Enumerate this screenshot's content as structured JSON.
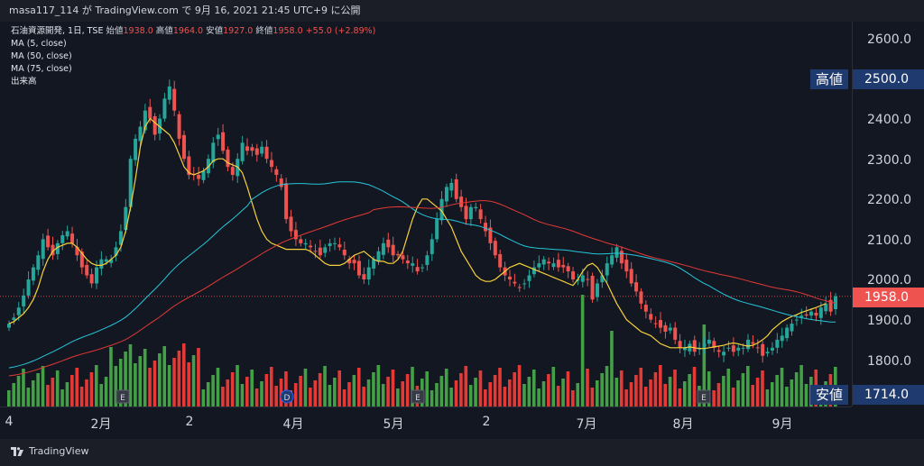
{
  "topbar": {
    "text": "masa117_114 が TradingView.com で 9月 16, 2021 21:45 UTC+9 に公開"
  },
  "legend": {
    "symbol": "石油資源開発, 1日, TSE",
    "open_label": "始値",
    "open": "1938.0",
    "high_label": "高値",
    "high": "1964.0",
    "low_label": "安値",
    "low": "1927.0",
    "close_label": "終値",
    "close": "1958.0",
    "change": "+55.0 (+2.89%)",
    "ma5": "MA (5, close)",
    "ma50": "MA (50, close)",
    "ma75": "MA (75, close)",
    "volume": "出来高"
  },
  "price_axis": {
    "ticks": [
      "2600.0",
      "2400.0",
      "2300.0",
      "2200.0",
      "2100.0",
      "2000.0",
      "1900.0",
      "1800.0"
    ],
    "high_tag": "2500.0",
    "last_tag": "1958.0",
    "low_tag": "1714.0",
    "high_name": "高値",
    "low_name": "安値"
  },
  "time_axis": {
    "labels": [
      "4",
      "2月",
      "2",
      "4月",
      "5月",
      "2",
      "7月",
      "8月",
      "9月"
    ]
  },
  "markers": {
    "earnings": "E",
    "dividend": "D"
  },
  "footer": {
    "brand": "TradingView"
  },
  "colors": {
    "up": "#26a69a",
    "down": "#ef5350",
    "ma5": "#f7d13b",
    "ma50": "#26c6da",
    "ma75": "#e53935",
    "vol_up": "#43a047",
    "vol_down": "#e53935",
    "tag_bg": "#1e3a6e",
    "last_bg": "#ef5350"
  },
  "chart_data": {
    "type": "candlestick",
    "title": "石油資源開発, 1日, TSE",
    "ylim": [
      1700,
      2650
    ],
    "price_ticks": [
      1800,
      1900,
      2000,
      2100,
      2200,
      2300,
      2400,
      2600
    ],
    "last_price": 1958.0,
    "period_high": 2500.0,
    "period_low": 1714.0,
    "ohlc_last": {
      "open": 1938.0,
      "high": 1964.0,
      "low": 1927.0,
      "close": 1958.0,
      "change": 55.0,
      "change_pct": 2.89
    },
    "close": [
      1890,
      1905,
      1930,
      1960,
      2000,
      2030,
      2060,
      2100,
      2080,
      2060,
      2090,
      2110,
      2120,
      2090,
      2060,
      2030,
      2010,
      1990,
      2030,
      2050,
      2050,
      2050,
      2080,
      2120,
      2180,
      2300,
      2350,
      2380,
      2420,
      2400,
      2360,
      2400,
      2450,
      2480,
      2420,
      2350,
      2300,
      2260,
      2260,
      2250,
      2270,
      2300,
      2340,
      2360,
      2320,
      2280,
      2260,
      2300,
      2340,
      2320,
      2320,
      2310,
      2330,
      2300,
      2280,
      2260,
      2230,
      2150,
      2120,
      2100,
      2090,
      2090,
      2080,
      2070,
      2060,
      2080,
      2090,
      2090,
      2080,
      2060,
      2040,
      2040,
      2010,
      2000,
      2030,
      2050,
      2070,
      2090,
      2080,
      2060,
      2060,
      2050,
      2040,
      2040,
      2020,
      2030,
      2060,
      2100,
      2150,
      2200,
      2230,
      2240,
      2200,
      2180,
      2150,
      2180,
      2180,
      2150,
      2120,
      2090,
      2060,
      2030,
      2010,
      2000,
      1990,
      1980,
      1990,
      2010,
      2030,
      2040,
      2050,
      2040,
      2040,
      2030,
      2030,
      2020,
      2000,
      2000,
      2010,
      2000,
      1950,
      1990,
      2010,
      2040,
      2060,
      2080,
      2040,
      2020,
      1990,
      1970,
      1940,
      1920,
      1900,
      1890,
      1880,
      1870,
      1880,
      1850,
      1830,
      1830,
      1840,
      1820,
      1830,
      1840,
      1850,
      1830,
      1820,
      1820,
      1830,
      1820,
      1830,
      1830,
      1850,
      1840,
      1830,
      1810,
      1820,
      1830,
      1850,
      1860,
      1880,
      1890,
      1900,
      1910,
      1910,
      1920,
      1910,
      1930,
      1940,
      1920,
      1958
    ],
    "ma5": [
      1890,
      1895,
      1905,
      1915,
      1930,
      1950,
      1980,
      2020,
      2050,
      2070,
      2080,
      2085,
      2090,
      2090,
      2080,
      2065,
      2050,
      2040,
      2035,
      2035,
      2040,
      2050,
      2060,
      2080,
      2120,
      2180,
      2250,
      2330,
      2380,
      2400,
      2390,
      2380,
      2370,
      2360,
      2340,
      2310,
      2280,
      2265,
      2260,
      2265,
      2270,
      2280,
      2295,
      2300,
      2300,
      2290,
      2285,
      2280,
      2265,
      2230,
      2190,
      2150,
      2120,
      2100,
      2090,
      2085,
      2080,
      2075,
      2075,
      2075,
      2075,
      2075,
      2070,
      2060,
      2050,
      2040,
      2035,
      2035,
      2035,
      2040,
      2050,
      2060,
      2065,
      2070,
      2060,
      2050,
      2045,
      2045,
      2040,
      2040,
      2050,
      2070,
      2110,
      2150,
      2180,
      2200,
      2200,
      2190,
      2180,
      2170,
      2150,
      2130,
      2100,
      2070,
      2050,
      2030,
      2010,
      2000,
      1995,
      1995,
      2000,
      2010,
      2020,
      2030,
      2035,
      2040,
      2035,
      2030,
      2025,
      2020,
      2015,
      2010,
      2005,
      2000,
      1995,
      1990,
      1985,
      2000,
      2020,
      2035,
      2040,
      2030,
      2010,
      1990,
      1965,
      1940,
      1920,
      1900,
      1890,
      1880,
      1870,
      1865,
      1860,
      1850,
      1840,
      1835,
      1830,
      1830,
      1830,
      1830,
      1832,
      1830,
      1828,
      1828,
      1830,
      1832,
      1834,
      1836,
      1840,
      1842,
      1840,
      1836,
      1834,
      1836,
      1842,
      1850,
      1860,
      1875,
      1885,
      1895,
      1902,
      1908,
      1912,
      1918,
      1922,
      1926,
      1930,
      1935,
      1940
    ]
  }
}
